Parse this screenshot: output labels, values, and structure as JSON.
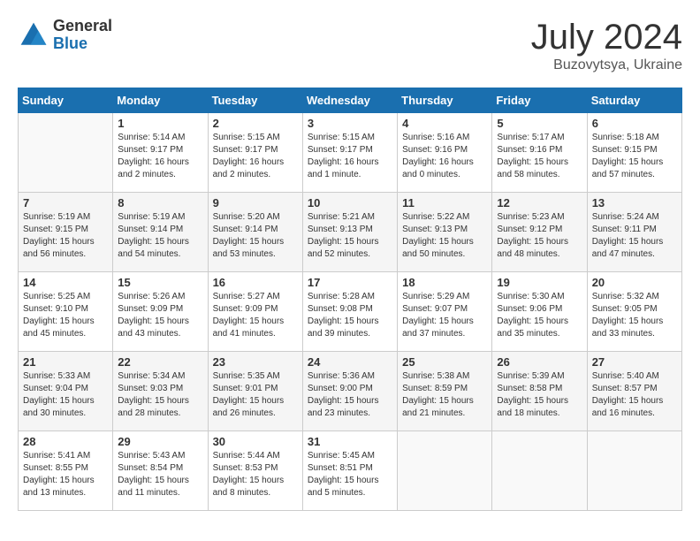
{
  "header": {
    "logo_general": "General",
    "logo_blue": "Blue",
    "month_title": "July 2024",
    "location": "Buzovytsya, Ukraine"
  },
  "days_of_week": [
    "Sunday",
    "Monday",
    "Tuesday",
    "Wednesday",
    "Thursday",
    "Friday",
    "Saturday"
  ],
  "weeks": [
    [
      {
        "day": "",
        "info": ""
      },
      {
        "day": "1",
        "info": "Sunrise: 5:14 AM\nSunset: 9:17 PM\nDaylight: 16 hours\nand 2 minutes."
      },
      {
        "day": "2",
        "info": "Sunrise: 5:15 AM\nSunset: 9:17 PM\nDaylight: 16 hours\nand 2 minutes."
      },
      {
        "day": "3",
        "info": "Sunrise: 5:15 AM\nSunset: 9:17 PM\nDaylight: 16 hours\nand 1 minute."
      },
      {
        "day": "4",
        "info": "Sunrise: 5:16 AM\nSunset: 9:16 PM\nDaylight: 16 hours\nand 0 minutes."
      },
      {
        "day": "5",
        "info": "Sunrise: 5:17 AM\nSunset: 9:16 PM\nDaylight: 15 hours\nand 58 minutes."
      },
      {
        "day": "6",
        "info": "Sunrise: 5:18 AM\nSunset: 9:15 PM\nDaylight: 15 hours\nand 57 minutes."
      }
    ],
    [
      {
        "day": "7",
        "info": "Sunrise: 5:19 AM\nSunset: 9:15 PM\nDaylight: 15 hours\nand 56 minutes."
      },
      {
        "day": "8",
        "info": "Sunrise: 5:19 AM\nSunset: 9:14 PM\nDaylight: 15 hours\nand 54 minutes."
      },
      {
        "day": "9",
        "info": "Sunrise: 5:20 AM\nSunset: 9:14 PM\nDaylight: 15 hours\nand 53 minutes."
      },
      {
        "day": "10",
        "info": "Sunrise: 5:21 AM\nSunset: 9:13 PM\nDaylight: 15 hours\nand 52 minutes."
      },
      {
        "day": "11",
        "info": "Sunrise: 5:22 AM\nSunset: 9:13 PM\nDaylight: 15 hours\nand 50 minutes."
      },
      {
        "day": "12",
        "info": "Sunrise: 5:23 AM\nSunset: 9:12 PM\nDaylight: 15 hours\nand 48 minutes."
      },
      {
        "day": "13",
        "info": "Sunrise: 5:24 AM\nSunset: 9:11 PM\nDaylight: 15 hours\nand 47 minutes."
      }
    ],
    [
      {
        "day": "14",
        "info": "Sunrise: 5:25 AM\nSunset: 9:10 PM\nDaylight: 15 hours\nand 45 minutes."
      },
      {
        "day": "15",
        "info": "Sunrise: 5:26 AM\nSunset: 9:09 PM\nDaylight: 15 hours\nand 43 minutes."
      },
      {
        "day": "16",
        "info": "Sunrise: 5:27 AM\nSunset: 9:09 PM\nDaylight: 15 hours\nand 41 minutes."
      },
      {
        "day": "17",
        "info": "Sunrise: 5:28 AM\nSunset: 9:08 PM\nDaylight: 15 hours\nand 39 minutes."
      },
      {
        "day": "18",
        "info": "Sunrise: 5:29 AM\nSunset: 9:07 PM\nDaylight: 15 hours\nand 37 minutes."
      },
      {
        "day": "19",
        "info": "Sunrise: 5:30 AM\nSunset: 9:06 PM\nDaylight: 15 hours\nand 35 minutes."
      },
      {
        "day": "20",
        "info": "Sunrise: 5:32 AM\nSunset: 9:05 PM\nDaylight: 15 hours\nand 33 minutes."
      }
    ],
    [
      {
        "day": "21",
        "info": "Sunrise: 5:33 AM\nSunset: 9:04 PM\nDaylight: 15 hours\nand 30 minutes."
      },
      {
        "day": "22",
        "info": "Sunrise: 5:34 AM\nSunset: 9:03 PM\nDaylight: 15 hours\nand 28 minutes."
      },
      {
        "day": "23",
        "info": "Sunrise: 5:35 AM\nSunset: 9:01 PM\nDaylight: 15 hours\nand 26 minutes."
      },
      {
        "day": "24",
        "info": "Sunrise: 5:36 AM\nSunset: 9:00 PM\nDaylight: 15 hours\nand 23 minutes."
      },
      {
        "day": "25",
        "info": "Sunrise: 5:38 AM\nSunset: 8:59 PM\nDaylight: 15 hours\nand 21 minutes."
      },
      {
        "day": "26",
        "info": "Sunrise: 5:39 AM\nSunset: 8:58 PM\nDaylight: 15 hours\nand 18 minutes."
      },
      {
        "day": "27",
        "info": "Sunrise: 5:40 AM\nSunset: 8:57 PM\nDaylight: 15 hours\nand 16 minutes."
      }
    ],
    [
      {
        "day": "28",
        "info": "Sunrise: 5:41 AM\nSunset: 8:55 PM\nDaylight: 15 hours\nand 13 minutes."
      },
      {
        "day": "29",
        "info": "Sunrise: 5:43 AM\nSunset: 8:54 PM\nDaylight: 15 hours\nand 11 minutes."
      },
      {
        "day": "30",
        "info": "Sunrise: 5:44 AM\nSunset: 8:53 PM\nDaylight: 15 hours\nand 8 minutes."
      },
      {
        "day": "31",
        "info": "Sunrise: 5:45 AM\nSunset: 8:51 PM\nDaylight: 15 hours\nand 5 minutes."
      },
      {
        "day": "",
        "info": ""
      },
      {
        "day": "",
        "info": ""
      },
      {
        "day": "",
        "info": ""
      }
    ]
  ]
}
